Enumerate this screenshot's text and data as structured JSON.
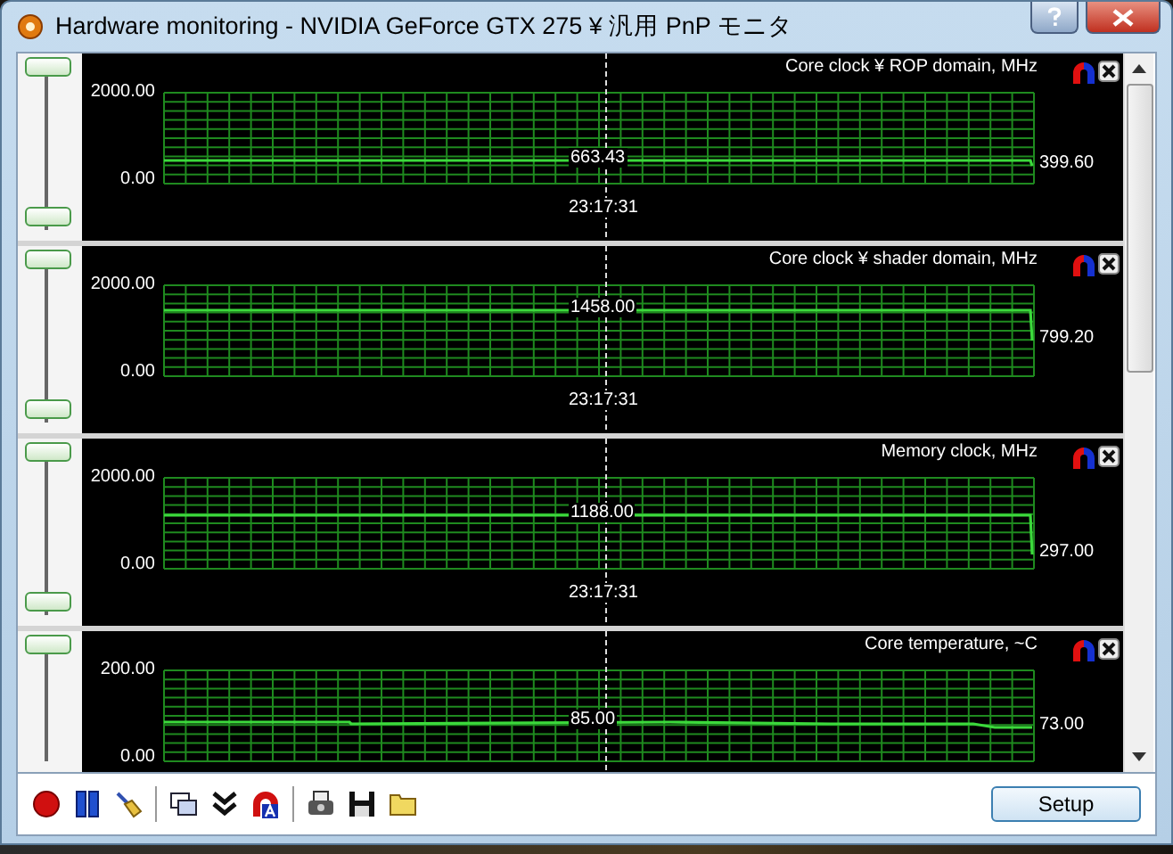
{
  "window": {
    "title": "Hardware monitoring - NVIDIA GeForce GTX 275 ¥ 汎用 PnP モニタ"
  },
  "graphs": [
    {
      "title": "Core clock ¥ ROP domain, MHz",
      "y_max": "2000.00",
      "y_min": "0.00",
      "cursor_value": "663.43",
      "current_value": "399.60",
      "time": "23:17:31"
    },
    {
      "title": "Core clock ¥ shader domain, MHz",
      "y_max": "2000.00",
      "y_min": "0.00",
      "cursor_value": "1458.00",
      "current_value": "799.20",
      "time": "23:17:31"
    },
    {
      "title": "Memory clock, MHz",
      "y_max": "2000.00",
      "y_min": "0.00",
      "cursor_value": "1188.00",
      "current_value": "297.00",
      "time": "23:17:31"
    },
    {
      "title": "Core temperature, ~C",
      "y_max": "200.00",
      "y_min": "0.00",
      "cursor_value": "85.00",
      "current_value": "73.00"
    }
  ],
  "setup_button": "Setup"
}
